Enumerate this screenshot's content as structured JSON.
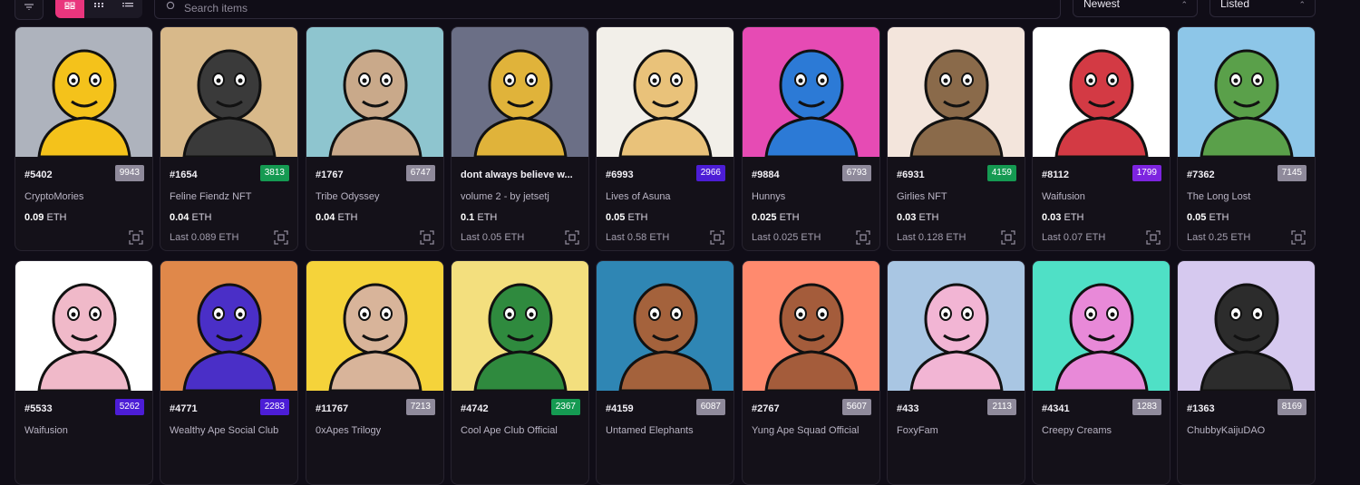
{
  "search": {
    "placeholder": "Search items"
  },
  "sort": {
    "selected": "Newest"
  },
  "status": {
    "selected": "Listed"
  },
  "colors": {
    "accent": "#e9357d",
    "badge_gray": "#8f8a9b",
    "badge_green": "#159a52",
    "badge_indigo": "#4c1dd6",
    "badge_purple": "#7d24e0"
  },
  "items": [
    {
      "id": "#5402",
      "rank": "9943",
      "rank_color": "badge_gray",
      "collection": "CryptoMories",
      "price_value": "0.09",
      "price_unit": "ETH",
      "last": "",
      "bg": "#aeb3bd",
      "fg": "#f4c21b"
    },
    {
      "id": "#1654",
      "rank": "3813",
      "rank_color": "badge_green",
      "collection": "Feline Fiendz NFT",
      "price_value": "0.04",
      "price_unit": "ETH",
      "last": "Last 0.089 ETH",
      "bg": "#d8b98a",
      "fg": "#3a3a3a"
    },
    {
      "id": "#1767",
      "rank": "6747",
      "rank_color": "badge_gray",
      "collection": "Tribe Odyssey",
      "price_value": "0.04",
      "price_unit": "ETH",
      "last": "",
      "bg": "#8ec5cf",
      "fg": "#c9a98a"
    },
    {
      "id": "dont always believe w...",
      "rank": "",
      "rank_color": "",
      "collection": "volume 2 - by jetsetj",
      "price_value": "0.1",
      "price_unit": "ETH",
      "last": "Last 0.05 ETH",
      "bg": "#6b6f86",
      "fg": "#e0b33a"
    },
    {
      "id": "#6993",
      "rank": "2966",
      "rank_color": "badge_indigo",
      "collection": "Lives of Asuna",
      "price_value": "0.05",
      "price_unit": "ETH",
      "last": "Last 0.58 ETH",
      "bg": "#f2efe9",
      "fg": "#e9c27a"
    },
    {
      "id": "#9884",
      "rank": "6793",
      "rank_color": "badge_gray",
      "collection": "Hunnys",
      "price_value": "0.025",
      "price_unit": "ETH",
      "last": "Last 0.025 ETH",
      "bg": "#e64bb4",
      "fg": "#2c7ad6"
    },
    {
      "id": "#6931",
      "rank": "4159",
      "rank_color": "badge_green",
      "collection": "Girlies NFT",
      "price_value": "0.03",
      "price_unit": "ETH",
      "last": "Last 0.128 ETH",
      "bg": "#f3e5dc",
      "fg": "#8a6a4a"
    },
    {
      "id": "#8112",
      "rank": "1799",
      "rank_color": "badge_purple",
      "collection": "Waifusion",
      "price_value": "0.03",
      "price_unit": "ETH",
      "last": "Last 0.07 ETH",
      "bg": "#ffffff",
      "fg": "#d33a44"
    },
    {
      "id": "#7362",
      "rank": "7145",
      "rank_color": "badge_gray",
      "collection": "The Long Lost",
      "price_value": "0.05",
      "price_unit": "ETH",
      "last": "Last 0.25 ETH",
      "bg": "#8dc6e8",
      "fg": "#5aa04a"
    },
    {
      "id": "#5533",
      "rank": "5262",
      "rank_color": "badge_indigo",
      "collection": "Waifusion",
      "price_value": "",
      "price_unit": "",
      "last": "",
      "bg": "#ffffff",
      "fg": "#f0b9c9"
    },
    {
      "id": "#4771",
      "rank": "2283",
      "rank_color": "badge_indigo",
      "collection": "Wealthy Ape Social Club",
      "price_value": "",
      "price_unit": "",
      "last": "",
      "bg": "#e0884a",
      "fg": "#4a2fc7"
    },
    {
      "id": "#11767",
      "rank": "7213",
      "rank_color": "badge_gray",
      "collection": "0xApes Trilogy",
      "price_value": "",
      "price_unit": "",
      "last": "",
      "bg": "#f5d33a",
      "fg": "#d8b49a"
    },
    {
      "id": "#4742",
      "rank": "2367",
      "rank_color": "badge_green",
      "collection": "Cool Ape Club Official",
      "price_value": "",
      "price_unit": "",
      "last": "",
      "bg": "#f3df7e",
      "fg": "#2f8a3e"
    },
    {
      "id": "#4159",
      "rank": "6087",
      "rank_color": "badge_gray",
      "collection": "Untamed Elephants",
      "price_value": "",
      "price_unit": "",
      "last": "",
      "bg": "#2f86b4",
      "fg": "#a4623c"
    },
    {
      "id": "#2767",
      "rank": "5607",
      "rank_color": "badge_gray",
      "collection": "Yung Ape Squad Official",
      "price_value": "",
      "price_unit": "",
      "last": "",
      "bg": "#ff8a6e",
      "fg": "#a45c3b"
    },
    {
      "id": "#433",
      "rank": "2113",
      "rank_color": "badge_gray",
      "collection": "FoxyFam",
      "price_value": "",
      "price_unit": "",
      "last": "",
      "bg": "#a9c6e3",
      "fg": "#f2b5d4"
    },
    {
      "id": "#4341",
      "rank": "1283",
      "rank_color": "badge_gray",
      "collection": "Creepy Creams",
      "price_value": "",
      "price_unit": "",
      "last": "",
      "bg": "#4fe0c6",
      "fg": "#e889d8"
    },
    {
      "id": "#1363",
      "rank": "8169",
      "rank_color": "badge_gray",
      "collection": "ChubbyKaijuDAO",
      "price_value": "",
      "price_unit": "",
      "last": "",
      "bg": "#d6c9ef",
      "fg": "#2c2c2c"
    }
  ]
}
